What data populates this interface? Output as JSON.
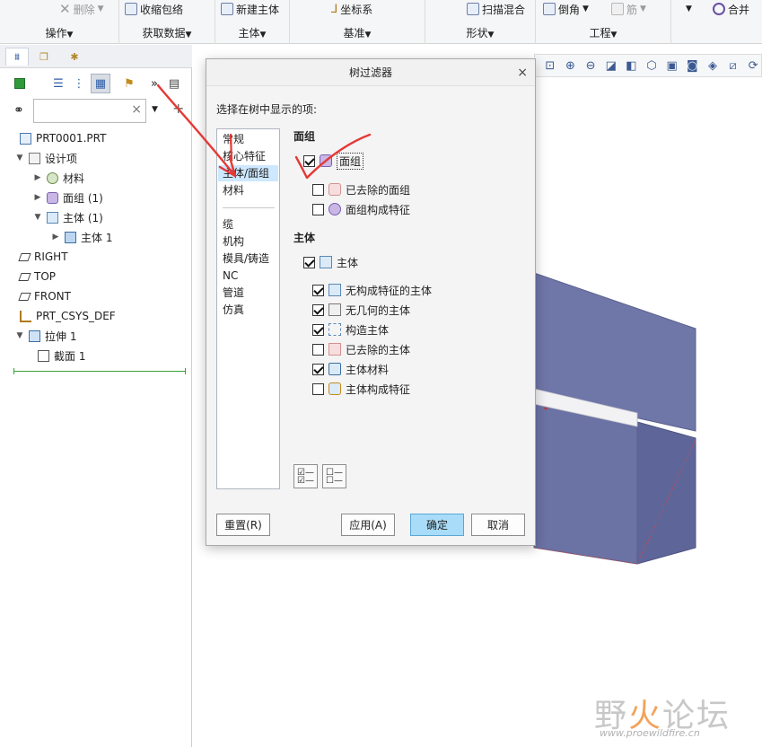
{
  "ribbon": {
    "groups": [
      {
        "label": "操作",
        "buttons": [
          "删除"
        ]
      },
      {
        "label": "获取数据",
        "buttons": [
          "收缩包络"
        ]
      },
      {
        "label": "主体",
        "buttons": [
          "新建主体"
        ]
      },
      {
        "label": "基准",
        "buttons": [
          "坐标系"
        ]
      },
      {
        "label": "形状",
        "buttons": [
          "扫描混合"
        ]
      },
      {
        "label": "工程",
        "buttons": [
          "倒角",
          "筋"
        ]
      },
      {
        "label": "",
        "buttons": [
          "合并"
        ]
      }
    ]
  },
  "model_tree": {
    "items": [
      {
        "label": "PRT0001.PRT",
        "level": 0,
        "expander": "",
        "icon": "part-icon"
      },
      {
        "label": "设计项",
        "level": 0,
        "expander": "expanded",
        "icon": "design-items-icon"
      },
      {
        "label": "材料",
        "level": 1,
        "expander": "collapsed",
        "icon": "material-icon"
      },
      {
        "label": "面组 (1)",
        "level": 1,
        "expander": "collapsed",
        "icon": "quilt-icon"
      },
      {
        "label": "主体 (1)",
        "level": 1,
        "expander": "expanded",
        "icon": "body-folder-icon"
      },
      {
        "label": "主体 1",
        "level": 2,
        "expander": "collapsed",
        "icon": "body-icon"
      },
      {
        "label": "RIGHT",
        "level": 0,
        "expander": "",
        "icon": "datum-plane-icon"
      },
      {
        "label": "TOP",
        "level": 0,
        "expander": "",
        "icon": "datum-plane-icon"
      },
      {
        "label": "FRONT",
        "level": 0,
        "expander": "",
        "icon": "datum-plane-icon"
      },
      {
        "label": "PRT_CSYS_DEF",
        "level": 0,
        "expander": "",
        "icon": "csys-icon"
      },
      {
        "label": "拉伸 1",
        "level": 0,
        "expander": "expanded",
        "icon": "extrude-icon"
      },
      {
        "label": "截面 1",
        "level": 1,
        "expander": "",
        "icon": "sketch-icon"
      }
    ],
    "search_value": "",
    "search_clear": "×"
  },
  "dialog": {
    "title": "树过滤器",
    "close": "×",
    "prompt": "选择在树中显示的项:",
    "categories_top": [
      "常规",
      "核心特征",
      "主体/面组",
      "材料"
    ],
    "categories_bottom": [
      "缆",
      "机构",
      "模具/铸造",
      "NC",
      "管道",
      "仿真"
    ],
    "selected_category": "主体/面组",
    "quilt_section": {
      "title": "面组",
      "master": {
        "label": "面组",
        "checked": true
      },
      "options": [
        {
          "label": "已去除的面组",
          "checked": false
        },
        {
          "label": "面组构成特征",
          "checked": false
        }
      ]
    },
    "body_section": {
      "title": "主体",
      "master": {
        "label": "主体",
        "checked": true
      },
      "options": [
        {
          "label": "无构成特征的主体",
          "checked": true
        },
        {
          "label": "无几何的主体",
          "checked": true
        },
        {
          "label": "构造主体",
          "checked": true
        },
        {
          "label": "已去除的主体",
          "checked": false
        },
        {
          "label": "主体材料",
          "checked": true
        },
        {
          "label": "主体构成特征",
          "checked": false
        }
      ]
    },
    "buttons": {
      "reset": "重置(R)",
      "apply": "应用(A)",
      "ok": "确定",
      "cancel": "取消"
    }
  },
  "watermark": {
    "text_main": "野火论坛",
    "url": "www.proewildfire.cn"
  },
  "colors": {
    "accent": "#a8dcf8",
    "selected_row": "#cde8ff",
    "annotation": "#e53935",
    "model_face": "#6f76a8"
  }
}
